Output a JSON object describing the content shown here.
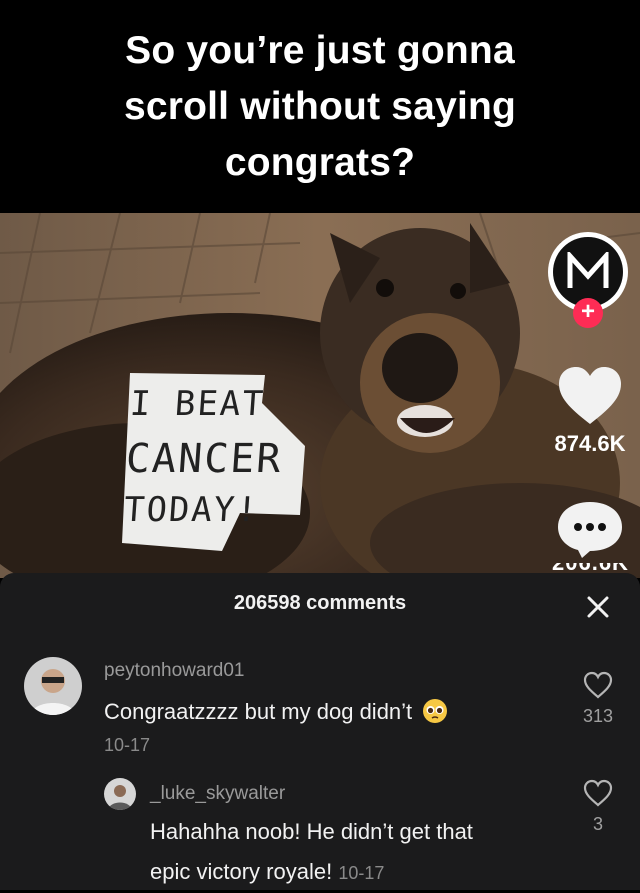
{
  "caption": {
    "text": "So you’re just gonna\nscroll without saying\ncongrats?"
  },
  "photo": {
    "sign": {
      "line1": "I BEAT",
      "line2": "CANCER",
      "line3": "TODAY!"
    }
  },
  "side_rail": {
    "avatar_letter": "M",
    "follow_symbol": "+",
    "likes": "874.6K",
    "comment_icon_dots": "•••"
  },
  "comments_sheet": {
    "title": "206598 comments",
    "close_symbol": "✕",
    "comments": [
      {
        "username": "peytonhoward01",
        "text": "Congraatzzzz but my dog didn’t",
        "emoji": "pleading-face",
        "date": "10-17",
        "likes": "313"
      },
      {
        "username": "_luke_skywalter",
        "text_line1": "Hahahha noob! He didn’t get that",
        "text_line2": "epic victory royale!",
        "date": "10-17",
        "likes": "3"
      }
    ]
  },
  "colors": {
    "background": "#000000",
    "sheet": "#1b1b1c",
    "accent_red": "#fe2c55",
    "muted_text": "#9a9a9a"
  }
}
